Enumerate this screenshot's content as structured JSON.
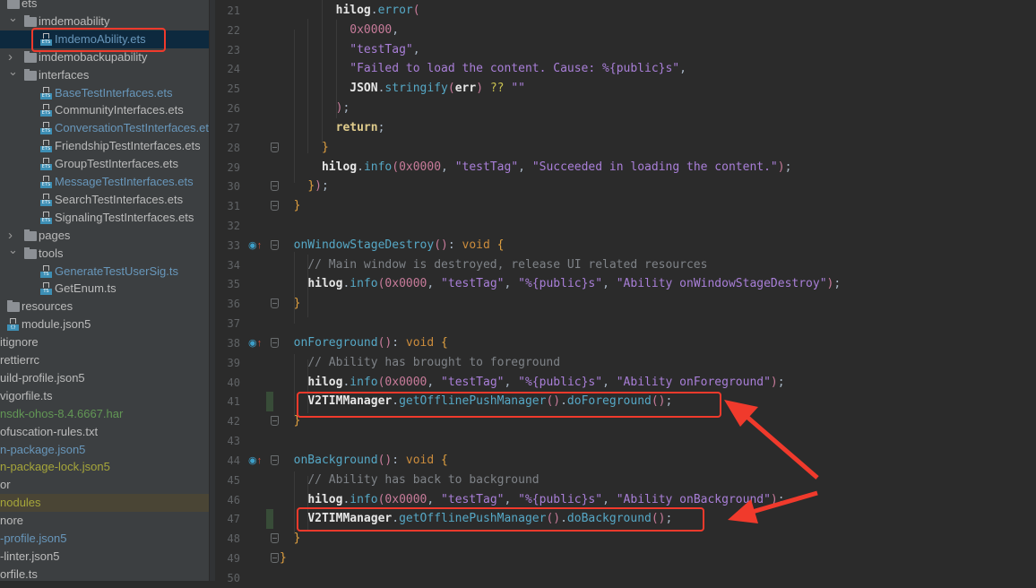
{
  "project_tree": {
    "items": [
      {
        "label": "ets",
        "kind": "folder",
        "expanded": true,
        "color": "default"
      },
      {
        "label": "imdemoability",
        "kind": "folder",
        "expanded": true,
        "color": "default"
      },
      {
        "label": "ImdemoAbility.ets",
        "kind": "ets",
        "selected": true,
        "highlighted_box": true,
        "color": "blue"
      },
      {
        "label": "imdemobackupability",
        "kind": "folder",
        "expanded": false,
        "color": "default"
      },
      {
        "label": "interfaces",
        "kind": "folder",
        "expanded": true,
        "color": "default"
      },
      {
        "label": "BaseTestInterfaces.ets",
        "kind": "ets",
        "color": "blue"
      },
      {
        "label": "CommunityInterfaces.ets",
        "kind": "ets",
        "color": "default"
      },
      {
        "label": "ConversationTestInterfaces.ets",
        "kind": "ets",
        "color": "blue"
      },
      {
        "label": "FriendshipTestInterfaces.ets",
        "kind": "ets",
        "color": "default"
      },
      {
        "label": "GroupTestInterfaces.ets",
        "kind": "ets",
        "color": "default"
      },
      {
        "label": "MessageTestInterfaces.ets",
        "kind": "ets",
        "color": "blue"
      },
      {
        "label": "SearchTestInterfaces.ets",
        "kind": "ets",
        "color": "default"
      },
      {
        "label": "SignalingTestInterfaces.ets",
        "kind": "ets",
        "color": "default"
      },
      {
        "label": "pages",
        "kind": "folder",
        "expanded": false,
        "color": "default"
      },
      {
        "label": "tools",
        "kind": "folder",
        "expanded": true,
        "color": "default"
      },
      {
        "label": "GenerateTestUserSig.ts",
        "kind": "ts",
        "color": "blue"
      },
      {
        "label": "GetEnum.ts",
        "kind": "ts",
        "color": "default"
      },
      {
        "label": "resources",
        "kind": "folder",
        "color": "default"
      },
      {
        "label": "module.json5",
        "kind": "json",
        "color": "default"
      },
      {
        "label": "itignore",
        "kind": "file",
        "color": "default"
      },
      {
        "label": "rettierrc",
        "kind": "file",
        "color": "default"
      },
      {
        "label": "uild-profile.json5",
        "kind": "file",
        "color": "default"
      },
      {
        "label": "vigorfile.ts",
        "kind": "file",
        "color": "default"
      },
      {
        "label": "nsdk-ohos-8.4.6667.har",
        "kind": "file",
        "color": "green"
      },
      {
        "label": "ofuscation-rules.txt",
        "kind": "file",
        "color": "default"
      },
      {
        "label": "n-package.json5",
        "kind": "file",
        "color": "blue"
      },
      {
        "label": "n-package-lock.json5",
        "kind": "file",
        "color": "olive"
      },
      {
        "label": "or",
        "kind": "file",
        "color": "default"
      },
      {
        "label": "nodules",
        "kind": "file",
        "color": "olive",
        "highlighted": true
      },
      {
        "label": "nore",
        "kind": "file",
        "color": "default"
      },
      {
        "label": "-profile.json5",
        "kind": "file",
        "color": "blue"
      },
      {
        "label": "-linter.json5",
        "kind": "file",
        "color": "default"
      },
      {
        "label": "orfile.ts",
        "kind": "file",
        "color": "default"
      }
    ]
  },
  "editor": {
    "lines": [
      {
        "n": "21",
        "tokens": [
          [
            "        ",
            "p"
          ],
          [
            "hilog",
            "id"
          ],
          [
            ".",
            "p"
          ],
          [
            "error",
            "meth"
          ],
          [
            "(",
            "par"
          ]
        ]
      },
      {
        "n": "22",
        "tokens": [
          [
            "          ",
            "p"
          ],
          [
            "0x0000",
            "num"
          ],
          [
            ",",
            "p"
          ]
        ]
      },
      {
        "n": "23",
        "tokens": [
          [
            "          ",
            "p"
          ],
          [
            "\"testTag\"",
            "str"
          ],
          [
            ",",
            "p"
          ]
        ]
      },
      {
        "n": "24",
        "tokens": [
          [
            "          ",
            "p"
          ],
          [
            "\"Failed to load the content. Cause: %{public}s\"",
            "str"
          ],
          [
            ",",
            "p"
          ]
        ]
      },
      {
        "n": "25",
        "tokens": [
          [
            "          ",
            "p"
          ],
          [
            "JSON",
            "id"
          ],
          [
            ".",
            "p"
          ],
          [
            "stringify",
            "meth"
          ],
          [
            "(",
            "par"
          ],
          [
            "err",
            "id"
          ],
          [
            ")",
            "par"
          ],
          [
            " ?? ",
            "op"
          ],
          [
            "\"\"",
            "str"
          ]
        ]
      },
      {
        "n": "26",
        "tokens": [
          [
            "        ",
            "p"
          ],
          [
            ")",
            "par"
          ],
          [
            ";",
            "p"
          ]
        ]
      },
      {
        "n": "27",
        "tokens": [
          [
            "        ",
            "p"
          ],
          [
            "return",
            "ret"
          ],
          [
            ";",
            "p"
          ]
        ]
      },
      {
        "n": "28",
        "fold": true,
        "tokens": [
          [
            "      ",
            "p"
          ],
          [
            "}",
            "brace"
          ]
        ]
      },
      {
        "n": "29",
        "tokens": [
          [
            "      ",
            "p"
          ],
          [
            "hilog",
            "id"
          ],
          [
            ".",
            "p"
          ],
          [
            "info",
            "meth"
          ],
          [
            "(",
            "par"
          ],
          [
            "0x0000",
            "num"
          ],
          [
            ", ",
            "p"
          ],
          [
            "\"testTag\"",
            "str"
          ],
          [
            ", ",
            "p"
          ],
          [
            "\"Succeeded in loading the content.\"",
            "str"
          ],
          [
            ")",
            "par"
          ],
          [
            ";",
            "p"
          ]
        ]
      },
      {
        "n": "30",
        "fold": true,
        "tokens": [
          [
            "    ",
            "p"
          ],
          [
            "}",
            "brace"
          ],
          [
            ")",
            "par"
          ],
          [
            ";",
            "p"
          ]
        ]
      },
      {
        "n": "31",
        "fold": true,
        "tokens": [
          [
            "  ",
            "p"
          ],
          [
            "}",
            "brace"
          ]
        ]
      },
      {
        "n": "32",
        "tokens": []
      },
      {
        "n": "33",
        "override": true,
        "fold": true,
        "tokens": [
          [
            "  ",
            "p"
          ],
          [
            "onWindowStageDestroy",
            "fn"
          ],
          [
            "()",
            "par"
          ],
          [
            ": ",
            "p"
          ],
          [
            "void",
            "kw"
          ],
          [
            " {",
            "brace"
          ]
        ]
      },
      {
        "n": "34",
        "tokens": [
          [
            "    ",
            "p"
          ],
          [
            "// Main window is destroyed, release UI related resources",
            "cm"
          ]
        ]
      },
      {
        "n": "35",
        "tokens": [
          [
            "    ",
            "p"
          ],
          [
            "hilog",
            "id"
          ],
          [
            ".",
            "p"
          ],
          [
            "info",
            "meth"
          ],
          [
            "(",
            "par"
          ],
          [
            "0x0000",
            "num"
          ],
          [
            ", ",
            "p"
          ],
          [
            "\"testTag\"",
            "str"
          ],
          [
            ", ",
            "p"
          ],
          [
            "\"%{public}s\"",
            "str"
          ],
          [
            ", ",
            "p"
          ],
          [
            "\"Ability onWindowStageDestroy\"",
            "str"
          ],
          [
            ")",
            "par"
          ],
          [
            ";",
            "p"
          ]
        ]
      },
      {
        "n": "36",
        "fold": true,
        "tokens": [
          [
            "  ",
            "p"
          ],
          [
            "}",
            "brace"
          ]
        ]
      },
      {
        "n": "37",
        "tokens": []
      },
      {
        "n": "38",
        "override": true,
        "fold": true,
        "tokens": [
          [
            "  ",
            "p"
          ],
          [
            "onForeground",
            "fn"
          ],
          [
            "()",
            "par"
          ],
          [
            ": ",
            "p"
          ],
          [
            "void",
            "kw"
          ],
          [
            " {",
            "brace"
          ]
        ]
      },
      {
        "n": "39",
        "tokens": [
          [
            "    ",
            "p"
          ],
          [
            "// Ability has brought to foreground",
            "cm"
          ]
        ]
      },
      {
        "n": "40",
        "tokens": [
          [
            "    ",
            "p"
          ],
          [
            "hilog",
            "id"
          ],
          [
            ".",
            "p"
          ],
          [
            "info",
            "meth"
          ],
          [
            "(",
            "par"
          ],
          [
            "0x0000",
            "num"
          ],
          [
            ", ",
            "p"
          ],
          [
            "\"testTag\"",
            "str"
          ],
          [
            ", ",
            "p"
          ],
          [
            "\"%{public}s\"",
            "str"
          ],
          [
            ", ",
            "p"
          ],
          [
            "\"Ability onForeground\"",
            "str"
          ],
          [
            ")",
            "par"
          ],
          [
            ";",
            "p"
          ]
        ]
      },
      {
        "n": "41",
        "changed": true,
        "tokens": [
          [
            "    ",
            "p"
          ],
          [
            "V2TIMManager",
            "id"
          ],
          [
            ".",
            "p"
          ],
          [
            "getOfflinePushManager",
            "meth"
          ],
          [
            "()",
            "par"
          ],
          [
            ".",
            "p"
          ],
          [
            "doForeground",
            "meth"
          ],
          [
            "()",
            "par"
          ],
          [
            ";",
            "p"
          ]
        ]
      },
      {
        "n": "42",
        "fold": true,
        "tokens": [
          [
            "  ",
            "p"
          ],
          [
            "}",
            "brace"
          ]
        ]
      },
      {
        "n": "43",
        "tokens": []
      },
      {
        "n": "44",
        "override": true,
        "fold": true,
        "tokens": [
          [
            "  ",
            "p"
          ],
          [
            "onBackground",
            "fn"
          ],
          [
            "()",
            "par"
          ],
          [
            ": ",
            "p"
          ],
          [
            "void",
            "kw"
          ],
          [
            " {",
            "brace"
          ]
        ]
      },
      {
        "n": "45",
        "tokens": [
          [
            "    ",
            "p"
          ],
          [
            "// Ability has back to background",
            "cm"
          ]
        ]
      },
      {
        "n": "46",
        "tokens": [
          [
            "    ",
            "p"
          ],
          [
            "hilog",
            "id"
          ],
          [
            ".",
            "p"
          ],
          [
            "info",
            "meth"
          ],
          [
            "(",
            "par"
          ],
          [
            "0x0000",
            "num"
          ],
          [
            ", ",
            "p"
          ],
          [
            "\"testTag\"",
            "str"
          ],
          [
            ", ",
            "p"
          ],
          [
            "\"%{public}s\"",
            "str"
          ],
          [
            ", ",
            "p"
          ],
          [
            "\"Ability onBackground\"",
            "str"
          ],
          [
            ")",
            "par"
          ],
          [
            ";",
            "p"
          ]
        ]
      },
      {
        "n": "47",
        "changed": true,
        "tokens": [
          [
            "    ",
            "p"
          ],
          [
            "V2TIMManager",
            "id"
          ],
          [
            ".",
            "p"
          ],
          [
            "getOfflinePushManager",
            "meth"
          ],
          [
            "()",
            "par"
          ],
          [
            ".",
            "p"
          ],
          [
            "doBackground",
            "meth"
          ],
          [
            "()",
            "par"
          ],
          [
            ";",
            "p"
          ]
        ]
      },
      {
        "n": "48",
        "fold": true,
        "tokens": [
          [
            "  ",
            "p"
          ],
          [
            "}",
            "brace"
          ]
        ]
      },
      {
        "n": "49",
        "fold": true,
        "tokens": [
          [
            "}",
            "brace"
          ]
        ]
      },
      {
        "n": "50",
        "tokens": []
      }
    ]
  },
  "annotations": {
    "color": "#f03a2c",
    "boxes": [
      "sidebar-ImdemoAbility.ets",
      "line-41",
      "line-47"
    ],
    "arrows": [
      "to-line-41",
      "to-line-47"
    ]
  }
}
